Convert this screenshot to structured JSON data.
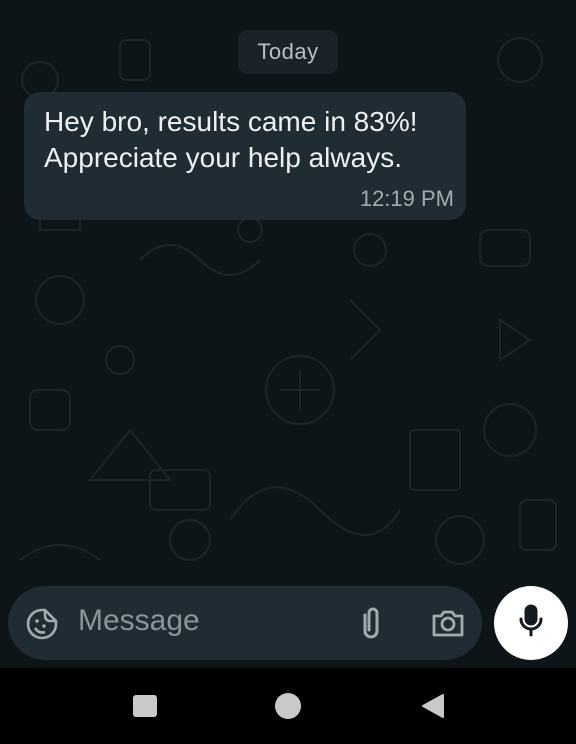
{
  "date_separator": "Today",
  "message": {
    "lines": [
      "Hey bro, results came in 83%!",
      "Appreciate your help always."
    ],
    "time": "12:19 PM",
    "bubble_color": "#1f2c33"
  },
  "composer": {
    "placeholder": "Message",
    "icons": [
      "sticker-icon",
      "paperclip-icon",
      "camera-icon"
    ]
  },
  "mic_button": {
    "icon": "microphone-icon",
    "color": "#ffffff"
  },
  "navigation": {
    "buttons": [
      "recents",
      "home",
      "back"
    ]
  },
  "colors": {
    "chat_background": "#0e1519",
    "text_primary": "#eef1f2",
    "text_secondary": "#a3abb0"
  }
}
